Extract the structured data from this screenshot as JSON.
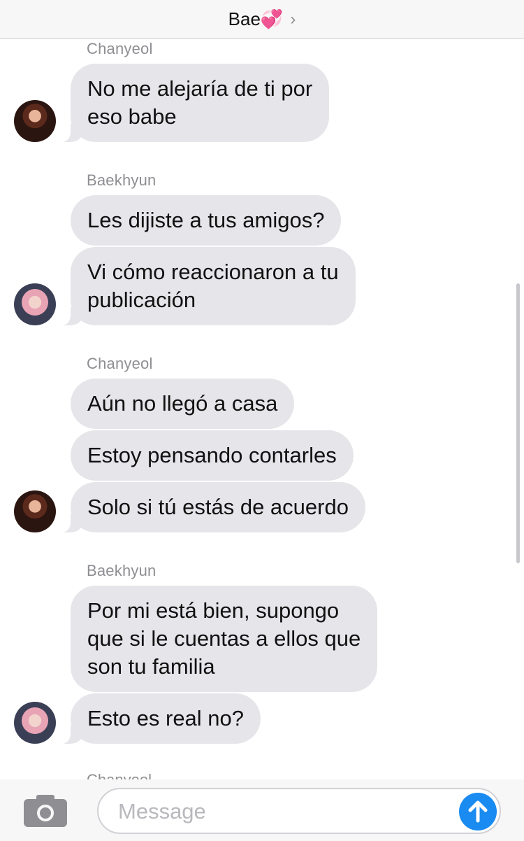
{
  "header": {
    "title": "Bae💞",
    "chevron": "›"
  },
  "thread": {
    "groups": [
      {
        "sender": "Chanyeol",
        "avatar": "chanyeol-avatar",
        "messages": [
          "No me alejaría de ti por\neso babe"
        ]
      },
      {
        "sender": "Baekhyun",
        "avatar": "baekhyun-avatar",
        "messages": [
          "Les dijiste a tus amigos?",
          "Vi cómo reaccionaron a tu\npublicación"
        ]
      },
      {
        "sender": "Chanyeol",
        "avatar": "chanyeol-avatar",
        "messages": [
          "Aún no llegó a casa",
          "Estoy pensando contarles",
          "Solo si tú estás de acuerdo"
        ]
      },
      {
        "sender": "Baekhyun",
        "avatar": "baekhyun-avatar",
        "messages": [
          "Por mi está bien, supongo\nque si le cuentas a ellos que\nson tu familia",
          "Esto es real no?"
        ]
      }
    ],
    "partial_sender": "Chanyeol"
  },
  "input_bar": {
    "camera_icon": "camera-icon",
    "placeholder": "Message",
    "send_icon": "arrow-up-icon"
  },
  "colors": {
    "bubble": "#e5e5ea",
    "send": "#1a8bf0",
    "sender_label": "#8e8e93"
  }
}
